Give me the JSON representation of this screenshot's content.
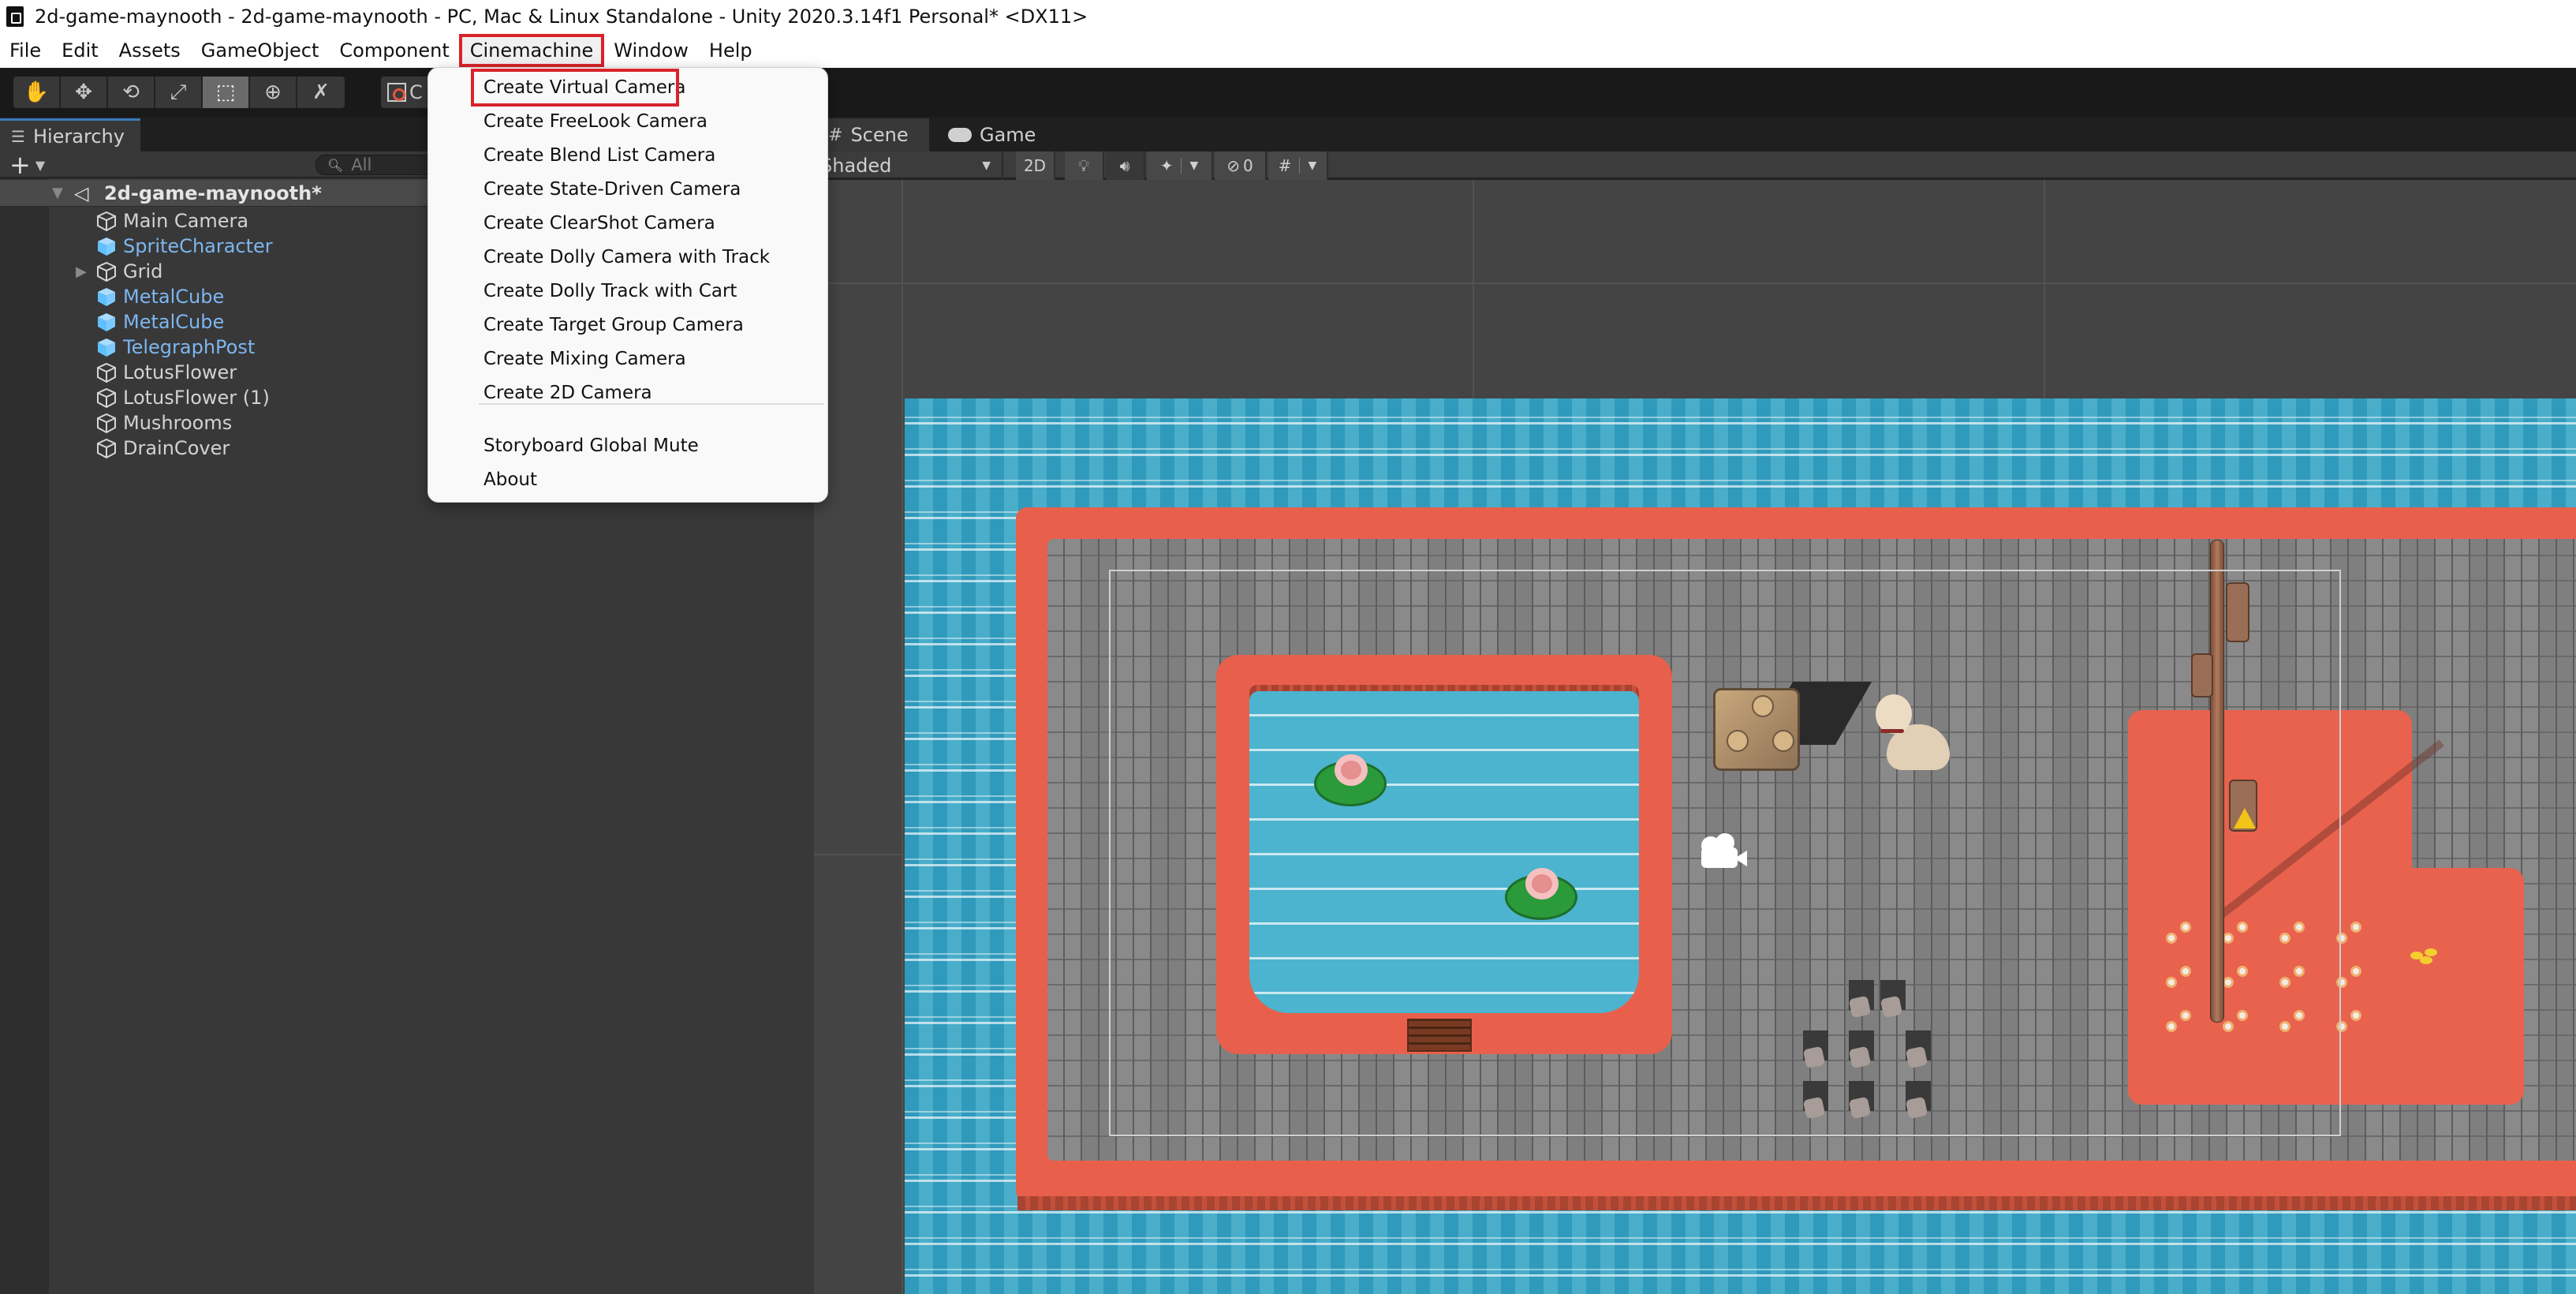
{
  "window": {
    "title": "2d-game-maynooth - 2d-game-maynooth - PC, Mac & Linux Standalone - Unity 2020.3.14f1 Personal* <DX11>",
    "icon": "unity-logo-icon"
  },
  "menubar": {
    "items": [
      {
        "label": "File"
      },
      {
        "label": "Edit"
      },
      {
        "label": "Assets"
      },
      {
        "label": "GameObject"
      },
      {
        "label": "Component"
      },
      {
        "label": "Cinemachine",
        "active": true
      },
      {
        "label": "Window"
      },
      {
        "label": "Help"
      }
    ]
  },
  "toolbar": {
    "tools": [
      {
        "name": "hand-tool",
        "icon": "hand-icon",
        "glyph": "✋"
      },
      {
        "name": "move-tool",
        "icon": "move-arrows-icon",
        "glyph": "✥"
      },
      {
        "name": "rotate-tool",
        "icon": "rotate-icon",
        "glyph": "⟲"
      },
      {
        "name": "scale-tool",
        "icon": "scale-icon",
        "glyph": "⤢"
      },
      {
        "name": "rect-tool",
        "icon": "rect-transform-icon",
        "glyph": "⬚",
        "active": true
      },
      {
        "name": "transform-tool",
        "icon": "transform-all-icon",
        "glyph": "⊕"
      },
      {
        "name": "custom-editor-tool",
        "icon": "wrench-pencil-icon",
        "glyph": "✗"
      }
    ],
    "pivot_label": "C"
  },
  "hierarchy": {
    "tab_label": "Hierarchy",
    "add_label": "+",
    "search_placeholder": "All",
    "scene_name": "2d-game-maynooth*",
    "items": [
      {
        "label": "Main Camera",
        "prefab": false,
        "expandable": false
      },
      {
        "label": "SpriteCharacter",
        "prefab": true,
        "expandable": false
      },
      {
        "label": "Grid",
        "prefab": false,
        "expandable": true
      },
      {
        "label": "MetalCube",
        "prefab": true,
        "expandable": false
      },
      {
        "label": "MetalCube",
        "prefab": true,
        "expandable": false
      },
      {
        "label": "TelegraphPost",
        "prefab": true,
        "expandable": false
      },
      {
        "label": "LotusFlower",
        "prefab": false,
        "expandable": false
      },
      {
        "label": "LotusFlower (1)",
        "prefab": false,
        "expandable": false
      },
      {
        "label": "Mushrooms",
        "prefab": false,
        "expandable": false
      },
      {
        "label": "DrainCover",
        "prefab": false,
        "expandable": false
      }
    ]
  },
  "scene": {
    "tabs": [
      {
        "label": "Scene",
        "icon": "grid-hash-icon",
        "glyph": "#",
        "active": true
      },
      {
        "label": "Game",
        "icon": "gamepad-icon",
        "glyph": "🎮",
        "active": false
      }
    ],
    "draw_mode": "Shaded",
    "mode_2d_label": "2D",
    "hidden_count": "0"
  },
  "cinemachine_menu": {
    "items": [
      {
        "label": "Create Virtual Camera",
        "highlighted": true
      },
      {
        "label": "Create FreeLook Camera"
      },
      {
        "label": "Create Blend List Camera"
      },
      {
        "label": "Create State-Driven Camera"
      },
      {
        "label": "Create ClearShot Camera"
      },
      {
        "label": "Create Dolly Camera with Track"
      },
      {
        "label": "Create Dolly Track with Cart"
      },
      {
        "label": "Create Target Group Camera"
      },
      {
        "label": "Create Mixing Camera"
      },
      {
        "label": "Create 2D Camera"
      }
    ],
    "footer_items": [
      {
        "label": "Storyboard Global Mute"
      },
      {
        "label": "About"
      }
    ]
  },
  "colors": {
    "highlight_outline": "#d8232a",
    "prefab_text": "#7db6ef",
    "water": "#3aa5c5",
    "rim": "#e8604c",
    "paving": "#8a8a8a"
  }
}
